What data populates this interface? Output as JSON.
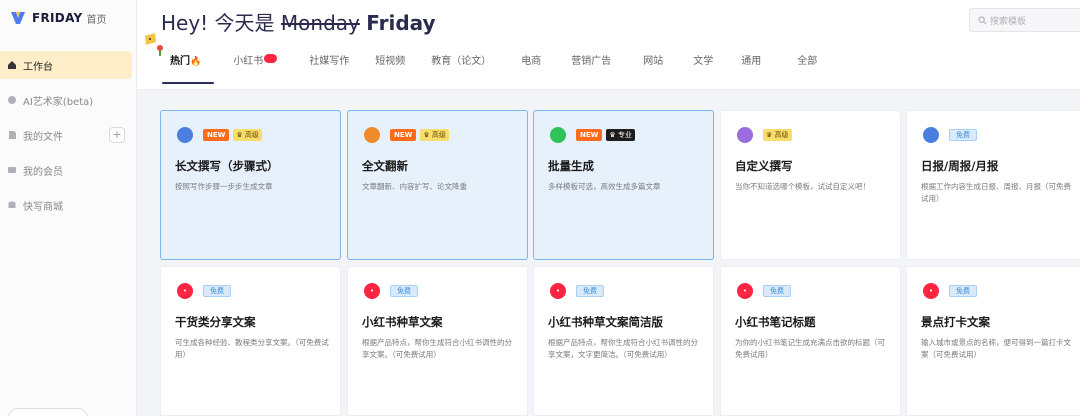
{
  "brand": {
    "name": "FRIDAY",
    "home": "首页",
    "accent": "#fdeec9"
  },
  "sidebar": {
    "items": [
      {
        "label": "工作台",
        "icon": "home-icon",
        "active": true
      },
      {
        "label": "AI艺术家(beta)",
        "icon": "palette-icon"
      },
      {
        "label": "我的文件",
        "icon": "file-icon",
        "plus": "+"
      },
      {
        "label": "我的会员",
        "icon": "card-icon"
      },
      {
        "label": "快写商城",
        "icon": "store-icon"
      }
    ]
  },
  "header": {
    "greeting_prefix": "Hey! 今天是",
    "greeting_strike": "Monday",
    "greeting_day": "Friday",
    "search_placeholder": "搜索模板"
  },
  "tabs": [
    {
      "label": "热门",
      "active": true
    },
    {
      "label": "小红书",
      "badge": "redbook"
    },
    {
      "label": "社媒写作"
    },
    {
      "label": "短视频"
    },
    {
      "label": "教育（论文）"
    },
    {
      "label": "电商"
    },
    {
      "label": "营销广告"
    },
    {
      "label": "网站"
    },
    {
      "label": "文学"
    },
    {
      "label": "通用"
    },
    {
      "label": "全部"
    }
  ],
  "cards": [
    {
      "title": "长文撰写（步骤式）",
      "desc": "按照写作步骤一步步生成文章",
      "icon": "pen-icon",
      "icon_color": "#4a7fe0",
      "tags": [
        "NEW",
        "♛ 高级"
      ],
      "highlight": true
    },
    {
      "title": "全文翻新",
      "desc": "文章翻新、内容扩写、论文降重",
      "icon": "doc-icon",
      "icon_color": "#f08a2a",
      "tags": [
        "NEW",
        "♛ 高级"
      ],
      "highlight": true
    },
    {
      "title": "批量生成",
      "desc": "多样模板可选，高效生成多篇文章",
      "icon": "wechat-icon",
      "icon_color": "#2ec25a",
      "tags": [
        "NEW",
        "♛ 专业"
      ],
      "highlight": true
    },
    {
      "title": "自定义撰写",
      "desc": "当你不知道选哪个模板，试试自定义吧！",
      "icon": "robot-icon",
      "icon_color": "#9b6be0",
      "tags": [
        "♛ 高级"
      ],
      "highlight": false
    },
    {
      "title": "日报/周报/月报",
      "desc": "根据工作内容生成日报、周报、月报（可免费试用）",
      "icon": "pen-icon",
      "icon_color": "#4a7fe0",
      "tags": [
        "免费"
      ],
      "highlight": false
    },
    {
      "title": "干货类分享文案",
      "desc": "可生成各种经验、教程类分享文案。（可免费试用）",
      "icon": "redbook-icon",
      "icon_color": "#ff2442",
      "tags": [
        "免费"
      ],
      "highlight": false
    },
    {
      "title": "小红书种草文案",
      "desc": "根据产品特点，帮你生成符合小红书调性的分享文案。（可免费试用）",
      "icon": "redbook-icon",
      "icon_color": "#ff2442",
      "tags": [
        "免费"
      ],
      "highlight": false
    },
    {
      "title": "小红书种草文案简洁版",
      "desc": "根据产品特点，帮你生成符合小红书调性的分享文案，文字更简洁。（可免费试用）",
      "icon": "redbook-icon",
      "icon_color": "#ff2442",
      "tags": [
        "免费"
      ],
      "highlight": false
    },
    {
      "title": "小红书笔记标题",
      "desc": "为你的小红书笔记生成充满点击欲的标题（可免费试用）",
      "icon": "redbook-icon",
      "icon_color": "#ff2442",
      "tags": [
        "免费"
      ],
      "highlight": false
    },
    {
      "title": "景点打卡文案",
      "desc": "输入城市或景点的名称，便可得到一篇打卡文案（可免费试用）",
      "icon": "redbook-icon",
      "icon_color": "#ff2442",
      "tags": [
        "免费"
      ],
      "highlight": false
    }
  ]
}
